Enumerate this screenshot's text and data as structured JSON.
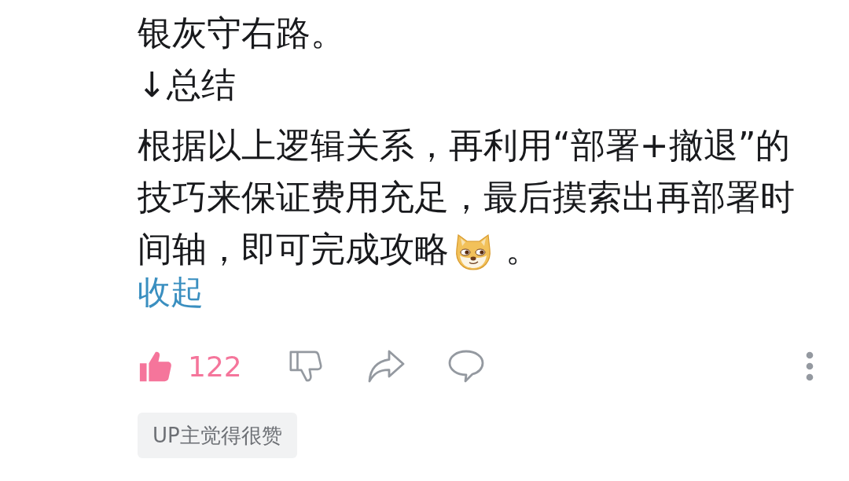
{
  "comment": {
    "paragraphs": [
      {
        "segments": [
          {
            "kind": "text",
            "text": "银灰守右路。"
          }
        ]
      },
      {
        "segments": [
          {
            "kind": "text",
            "text": "↓总结"
          }
        ]
      },
      {
        "segments": [
          {
            "kind": "text",
            "text": "根据以上逻辑关系，再利用“部署+撤退”的技巧来保证费用充足，最后摸索出再部署时间轴，即可完成攻略"
          },
          {
            "kind": "emoji"
          },
          {
            "kind": "text",
            "text": "。"
          }
        ]
      }
    ],
    "collapse_link": "收起"
  },
  "actions": {
    "like": {
      "on": true,
      "count": "122"
    },
    "dislike": {
      "on": false
    }
  },
  "badge": "UP主觉得很赞"
}
